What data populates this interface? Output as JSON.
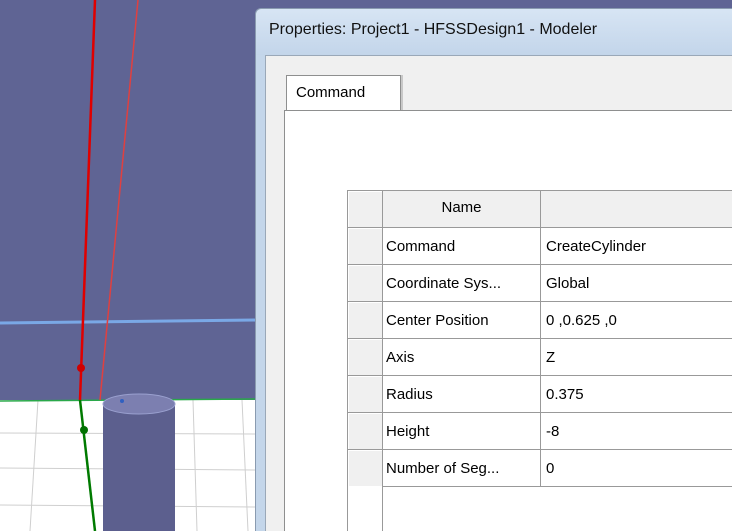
{
  "window": {
    "title": "Properties: Project1 - HFSSDesign1 - Modeler"
  },
  "tabs": [
    {
      "label": "Command"
    }
  ],
  "property_grid": {
    "header": {
      "name": "Name",
      "value": ""
    },
    "rows": [
      {
        "name": "Command",
        "value": "CreateCylinder"
      },
      {
        "name": "Coordinate Sys...",
        "value": "Global"
      },
      {
        "name": "Center Position",
        "value": "0 ,0.625 ,0"
      },
      {
        "name": "Axis",
        "value": "Z"
      },
      {
        "name": "Radius",
        "value": "0.375"
      },
      {
        "name": "Height",
        "value": "-8"
      },
      {
        "name": "Number of Seg...",
        "value": "0"
      }
    ]
  },
  "viewport": {
    "background_color": "#5f6494",
    "floor_color": "#ffffff",
    "x_axis_color": "#e00000",
    "y_axis_color": "#00a000",
    "horizon_color": "#6a9be0",
    "cylinder_color": "#5c5f8e"
  }
}
